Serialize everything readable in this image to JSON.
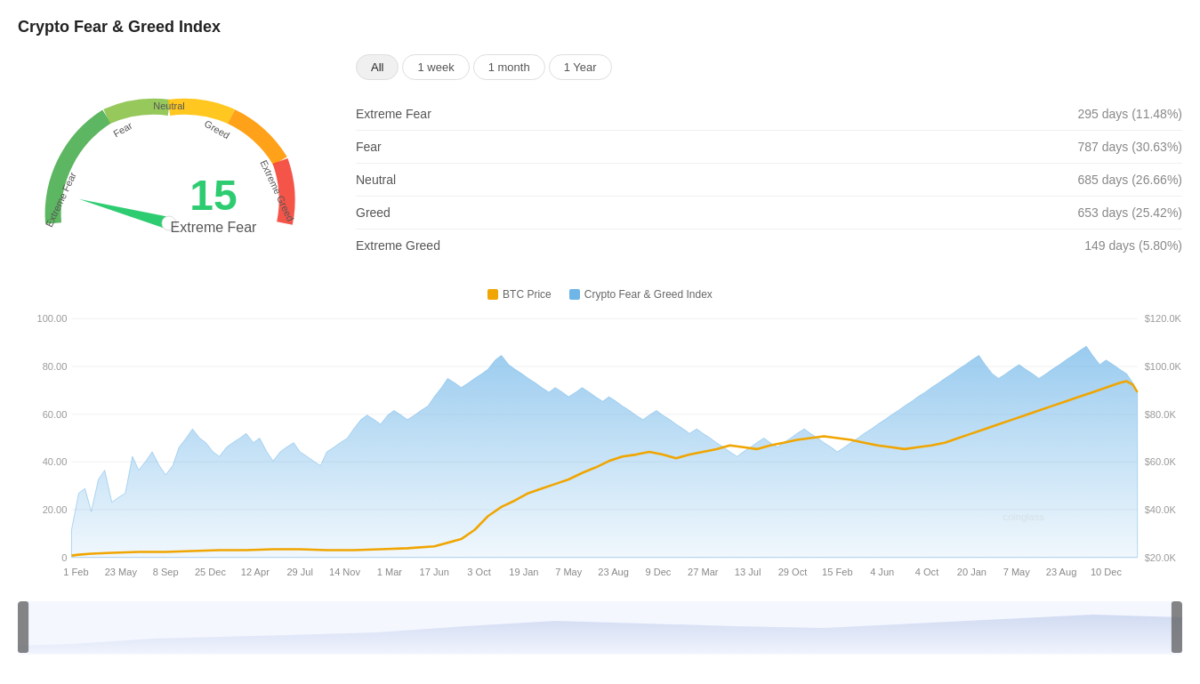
{
  "page": {
    "title": "Crypto Fear & Greed Index"
  },
  "gauge": {
    "value": 15,
    "label": "Extreme Fear",
    "zones": [
      "Extreme Fear",
      "Fear",
      "Neutral",
      "Greed",
      "Extreme Greed"
    ]
  },
  "filters": {
    "options": [
      "All",
      "1 week",
      "1 month",
      "1 Year"
    ],
    "active": "All"
  },
  "stats": [
    {
      "label": "Extreme Fear",
      "value": "295 days (11.48%)"
    },
    {
      "label": "Fear",
      "value": "787 days (30.63%)"
    },
    {
      "label": "Neutral",
      "value": "685 days (26.66%)"
    },
    {
      "label": "Greed",
      "value": "653 days (25.42%)"
    },
    {
      "label": "Extreme Greed",
      "value": "149 days (5.80%)"
    }
  ],
  "chart": {
    "legend": {
      "btc": {
        "label": "BTC Price",
        "color": "#F0A500"
      },
      "index": {
        "label": "Crypto Fear & Greed Index",
        "color": "#6EB5E8"
      }
    },
    "yAxisLeft": [
      "100.00",
      "80.00",
      "60.00",
      "40.00",
      "20.00",
      "0"
    ],
    "yAxisRight": [
      "$120.0K",
      "$100.0K",
      "$80.0K",
      "$60.0K",
      "$40.0K",
      "$20.0K"
    ],
    "xAxisLabels": [
      "1 Feb",
      "23 May",
      "8 Sep",
      "25 Dec",
      "12 Apr",
      "29 Jul",
      "14 Nov",
      "1 Mar",
      "17 Jun",
      "3 Oct",
      "19 Jan",
      "7 May",
      "23 Aug",
      "9 Dec",
      "27 Mar",
      "13 Jul",
      "29 Oct",
      "15 Feb",
      "4 Jun",
      "4 Oct",
      "20 Jan",
      "7 May",
      "23 Aug",
      "10 Dec"
    ],
    "watermark": "coinglass"
  }
}
